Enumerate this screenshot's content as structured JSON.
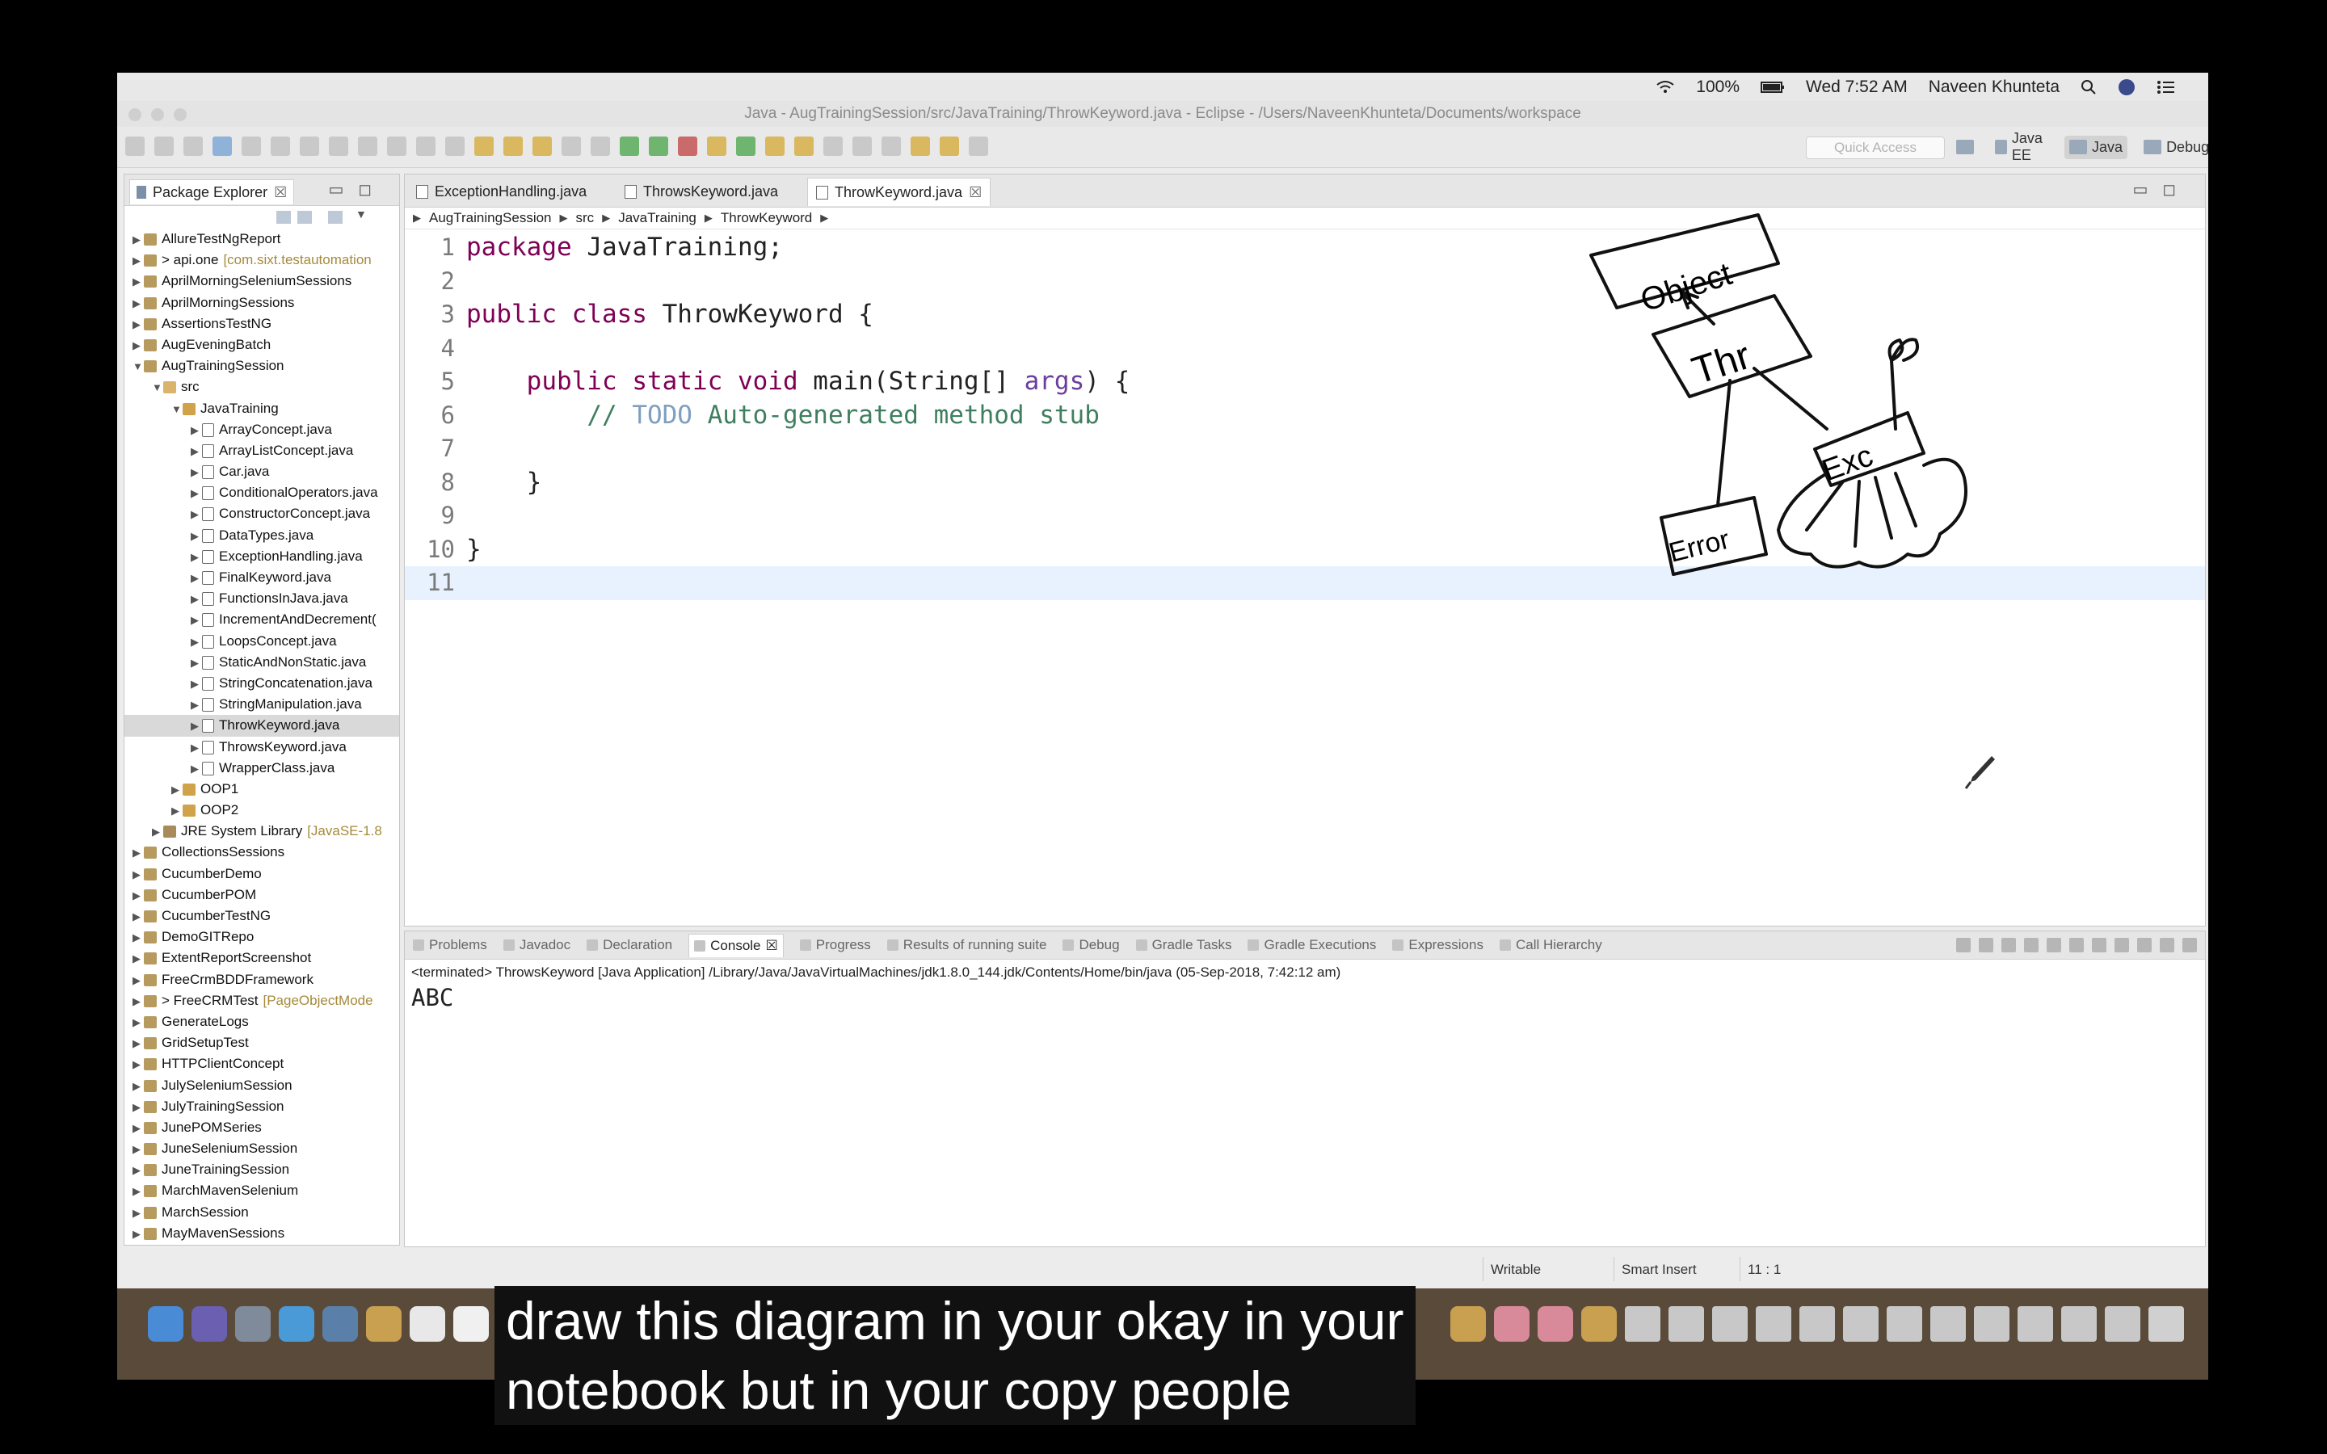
{
  "menubar": {
    "battery": "100%",
    "clock": "Wed 7:52 AM",
    "user": "Naveen Khunteta"
  },
  "window": {
    "title": "Java - AugTrainingSession/src/JavaTraining/ThrowKeyword.java - Eclipse - /Users/NaveenKhunteta/Documents/workspace"
  },
  "toolbar": {
    "quick_access_placeholder": "Quick Access",
    "perspectives": [
      "Java EE",
      "Java",
      "Debug"
    ]
  },
  "package_explorer": {
    "title": "Package Explorer",
    "items": [
      {
        "label": "AllureTestNgReport",
        "extra": "",
        "level": 0,
        "type": "proj",
        "arrow": "▶"
      },
      {
        "label": "> api.one",
        "extra": "[com.sixt.testautomation",
        "level": 0,
        "type": "proj",
        "arrow": "▶"
      },
      {
        "label": "AprilMorningSeleniumSessions",
        "extra": "",
        "level": 0,
        "type": "proj",
        "arrow": "▶"
      },
      {
        "label": "AprilMorningSessions",
        "extra": "",
        "level": 0,
        "type": "proj",
        "arrow": "▶"
      },
      {
        "label": "AssertionsTestNG",
        "extra": "",
        "level": 0,
        "type": "proj",
        "arrow": "▶"
      },
      {
        "label": "AugEveningBatch",
        "extra": "",
        "level": 0,
        "type": "proj",
        "arrow": "▶"
      },
      {
        "label": "AugTrainingSession",
        "extra": "",
        "level": 0,
        "type": "proj",
        "arrow": "▼"
      },
      {
        "label": "src",
        "extra": "",
        "level": 1,
        "type": "src",
        "arrow": "▼"
      },
      {
        "label": "JavaTraining",
        "extra": "",
        "level": 2,
        "type": "pkgi",
        "arrow": "▼"
      },
      {
        "label": "ArrayConcept.java",
        "extra": "",
        "level": 3,
        "type": "java",
        "arrow": "▶"
      },
      {
        "label": "ArrayListConcept.java",
        "extra": "",
        "level": 3,
        "type": "java",
        "arrow": "▶"
      },
      {
        "label": "Car.java",
        "extra": "",
        "level": 3,
        "type": "java",
        "arrow": "▶"
      },
      {
        "label": "ConditionalOperators.java",
        "extra": "",
        "level": 3,
        "type": "java",
        "arrow": "▶"
      },
      {
        "label": "ConstructorConcept.java",
        "extra": "",
        "level": 3,
        "type": "java",
        "arrow": "▶"
      },
      {
        "label": "DataTypes.java",
        "extra": "",
        "level": 3,
        "type": "java",
        "arrow": "▶"
      },
      {
        "label": "ExceptionHandling.java",
        "extra": "",
        "level": 3,
        "type": "java",
        "arrow": "▶"
      },
      {
        "label": "FinalKeyword.java",
        "extra": "",
        "level": 3,
        "type": "java",
        "arrow": "▶"
      },
      {
        "label": "FunctionsInJava.java",
        "extra": "",
        "level": 3,
        "type": "java",
        "arrow": "▶"
      },
      {
        "label": "IncrementAndDecrement(",
        "extra": "",
        "level": 3,
        "type": "java",
        "arrow": "▶"
      },
      {
        "label": "LoopsConcept.java",
        "extra": "",
        "level": 3,
        "type": "java",
        "arrow": "▶"
      },
      {
        "label": "StaticAndNonStatic.java",
        "extra": "",
        "level": 3,
        "type": "java",
        "arrow": "▶"
      },
      {
        "label": "StringConcatenation.java",
        "extra": "",
        "level": 3,
        "type": "java",
        "arrow": "▶"
      },
      {
        "label": "StringManipulation.java",
        "extra": "",
        "level": 3,
        "type": "java",
        "arrow": "▶"
      },
      {
        "label": "ThrowKeyword.java",
        "extra": "",
        "level": 3,
        "type": "java",
        "arrow": "▶",
        "selected": true
      },
      {
        "label": "ThrowsKeyword.java",
        "extra": "",
        "level": 3,
        "type": "java",
        "arrow": "▶"
      },
      {
        "label": "WrapperClass.java",
        "extra": "",
        "level": 3,
        "type": "java",
        "arrow": "▶"
      },
      {
        "label": "OOP1",
        "extra": "",
        "level": 2,
        "type": "pkgi",
        "arrow": "▶"
      },
      {
        "label": "OOP2",
        "extra": "",
        "level": 2,
        "type": "pkgi",
        "arrow": "▶"
      },
      {
        "label": "JRE System Library",
        "extra": "[JavaSE-1.8",
        "level": 1,
        "type": "lib",
        "arrow": "▶"
      },
      {
        "label": "CollectionsSessions",
        "extra": "",
        "level": 0,
        "type": "proj",
        "arrow": "▶"
      },
      {
        "label": "CucumberDemo",
        "extra": "",
        "level": 0,
        "type": "proj",
        "arrow": "▶"
      },
      {
        "label": "CucumberPOM",
        "extra": "",
        "level": 0,
        "type": "proj",
        "arrow": "▶"
      },
      {
        "label": "CucumberTestNG",
        "extra": "",
        "level": 0,
        "type": "proj",
        "arrow": "▶"
      },
      {
        "label": "DemoGITRepo",
        "extra": "",
        "level": 0,
        "type": "proj",
        "arrow": "▶"
      },
      {
        "label": "ExtentReportScreenshot",
        "extra": "",
        "level": 0,
        "type": "proj",
        "arrow": "▶"
      },
      {
        "label": "FreeCrmBDDFramework",
        "extra": "",
        "level": 0,
        "type": "proj",
        "arrow": "▶"
      },
      {
        "label": "> FreeCRMTest",
        "extra": "[PageObjectMode",
        "level": 0,
        "type": "proj",
        "arrow": "▶"
      },
      {
        "label": "GenerateLogs",
        "extra": "",
        "level": 0,
        "type": "proj",
        "arrow": "▶"
      },
      {
        "label": "GridSetupTest",
        "extra": "",
        "level": 0,
        "type": "proj",
        "arrow": "▶"
      },
      {
        "label": "HTTPClientConcept",
        "extra": "",
        "level": 0,
        "type": "proj",
        "arrow": "▶"
      },
      {
        "label": "JulySeleniumSession",
        "extra": "",
        "level": 0,
        "type": "proj",
        "arrow": "▶"
      },
      {
        "label": "JulyTrainingSession",
        "extra": "",
        "level": 0,
        "type": "proj",
        "arrow": "▶"
      },
      {
        "label": "JunePOMSeries",
        "extra": "",
        "level": 0,
        "type": "proj",
        "arrow": "▶"
      },
      {
        "label": "JuneSeleniumSession",
        "extra": "",
        "level": 0,
        "type": "proj",
        "arrow": "▶"
      },
      {
        "label": "JuneTrainingSession",
        "extra": "",
        "level": 0,
        "type": "proj",
        "arrow": "▶"
      },
      {
        "label": "MarchMavenSelenium",
        "extra": "",
        "level": 0,
        "type": "proj",
        "arrow": "▶"
      },
      {
        "label": "MarchSession",
        "extra": "",
        "level": 0,
        "type": "proj",
        "arrow": "▶"
      },
      {
        "label": "MayMavenSessions",
        "extra": "",
        "level": 0,
        "type": "proj",
        "arrow": "▶"
      }
    ]
  },
  "editor": {
    "tabs": [
      {
        "label": "ExceptionHandling.java",
        "active": false
      },
      {
        "label": "ThrowsKeyword.java",
        "active": false
      },
      {
        "label": "ThrowKeyword.java",
        "active": true
      }
    ],
    "close_glyph": "☒",
    "breadcrumb": [
      "AugTrainingSession",
      "src",
      "JavaTraining",
      "ThrowKeyword"
    ],
    "lines": [
      {
        "n": "1",
        "text": "package JavaTraining;"
      },
      {
        "n": "2",
        "text": ""
      },
      {
        "n": "3",
        "text": "public class ThrowKeyword {"
      },
      {
        "n": "4",
        "text": ""
      },
      {
        "n": "5",
        "text": "    public static void main(String[] args) {"
      },
      {
        "n": "6",
        "text": "        // TODO Auto-generated method stub"
      },
      {
        "n": "7",
        "text": ""
      },
      {
        "n": "8",
        "text": "    }"
      },
      {
        "n": "9",
        "text": ""
      },
      {
        "n": "10",
        "text": "}"
      },
      {
        "n": "11",
        "text": ""
      }
    ],
    "current_line": "11",
    "drawing_labels": {
      "object": "Object",
      "throwable": "Thr",
      "error": "Error",
      "exception": "Exc"
    }
  },
  "console": {
    "tabs": [
      "Problems",
      "Javadoc",
      "Declaration",
      "Console",
      "Progress",
      "Results of running suite",
      "Debug",
      "Gradle Tasks",
      "Gradle Executions",
      "Expressions",
      "Call Hierarchy"
    ],
    "active_tab": "Console",
    "terminated": "<terminated> ThrowsKeyword [Java Application] /Library/Java/JavaVirtualMachines/jdk1.8.0_144.jdk/Contents/Home/bin/java (05-Sep-2018, 7:42:12 am)",
    "output": "ABC"
  },
  "status": {
    "writable": "Writable",
    "insert_mode": "Smart Insert",
    "position": "11 : 1"
  },
  "subtitle": {
    "line1": "draw this diagram in your okay in your",
    "line2": "notebook but in your copy people"
  }
}
